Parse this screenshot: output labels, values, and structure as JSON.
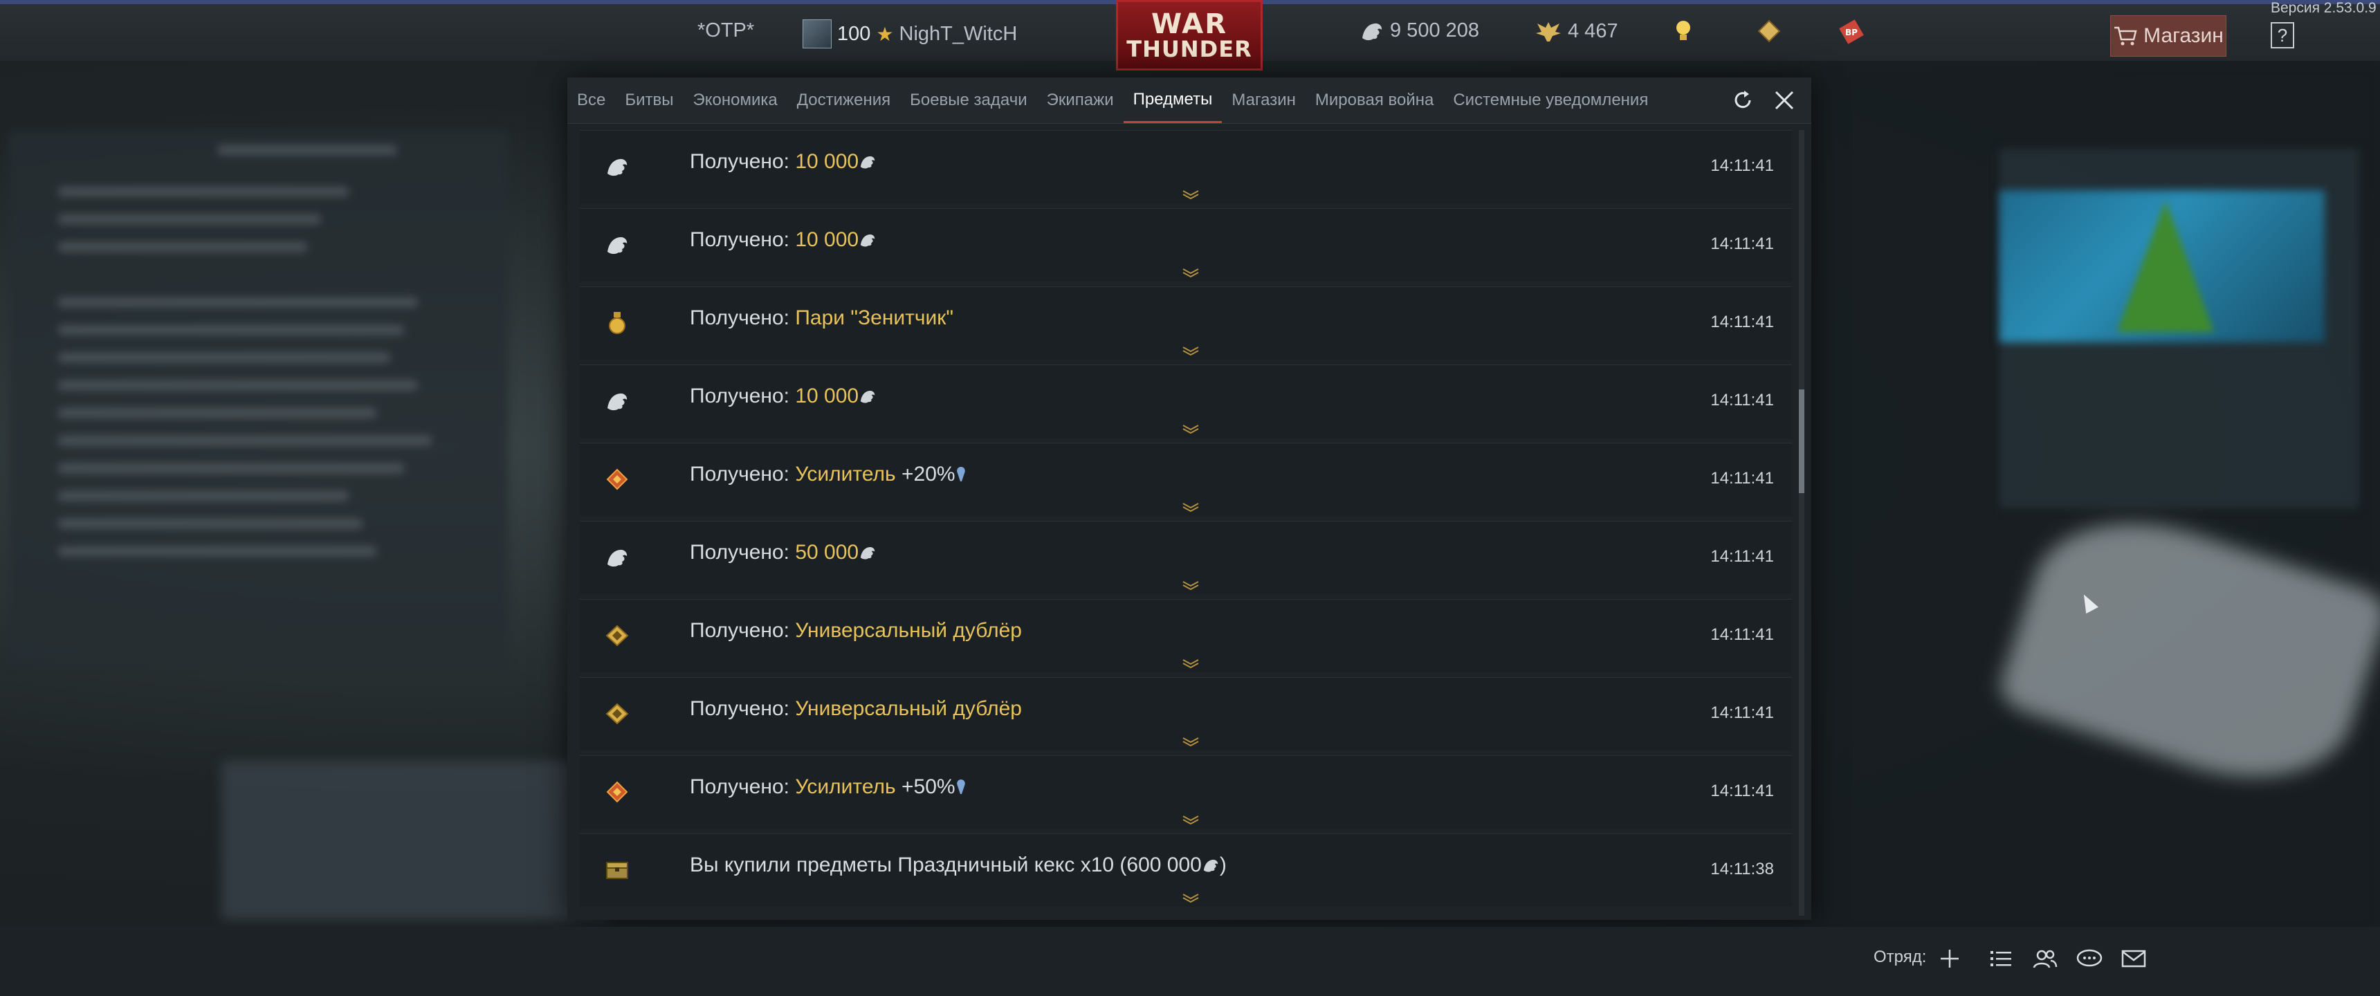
{
  "version": "Версия 2.53.0.9",
  "topbar": {
    "otp": "*ОТР*",
    "rank": "100",
    "nickname": "NighT_WitcH",
    "logo_line1": "WAR",
    "logo_line2": "THUNDER",
    "silver_lions": "9 500 208",
    "golden_eagles": "4 467",
    "shop_label": "Магазин",
    "help_label": "?"
  },
  "tabs": [
    {
      "label": "Все"
    },
    {
      "label": "Битвы"
    },
    {
      "label": "Экономика"
    },
    {
      "label": "Достижения"
    },
    {
      "label": "Боевые задачи"
    },
    {
      "label": "Экипажи"
    },
    {
      "label": "Предметы",
      "active": true
    },
    {
      "label": "Магазин"
    },
    {
      "label": "Мировая война"
    },
    {
      "label": "Системные уведомления"
    }
  ],
  "rows": [
    {
      "icon": "silver-lion-icon",
      "prefix": "Получено: ",
      "highlight": "10 000",
      "suffix": "",
      "time": "14:11:41"
    },
    {
      "icon": "silver-lion-icon",
      "prefix": "Получено: ",
      "highlight": "10 000",
      "suffix": "",
      "time": "14:11:41"
    },
    {
      "icon": "wager-medal-icon",
      "prefix": "Получено: ",
      "highlight": "Пари \"Зенитчик\"",
      "suffix": "",
      "time": "14:11:41"
    },
    {
      "icon": "silver-lion-icon",
      "prefix": "Получено: ",
      "highlight": "10 000",
      "suffix": "",
      "time": "14:11:41"
    },
    {
      "icon": "booster-icon",
      "prefix": "Получено: ",
      "highlight": "Усилитель",
      "suffix": " +20%",
      "time": "14:11:41"
    },
    {
      "icon": "silver-lion-icon",
      "prefix": "Получено: ",
      "highlight": "50 000",
      "suffix": "",
      "time": "14:11:41"
    },
    {
      "icon": "universal-backup-icon",
      "prefix": "Получено: ",
      "highlight": "Универсальный дублёр",
      "suffix": "",
      "time": "14:11:41"
    },
    {
      "icon": "universal-backup-icon",
      "prefix": "Получено: ",
      "highlight": "Универсальный дублёр",
      "suffix": "",
      "time": "14:11:41"
    },
    {
      "icon": "booster-icon",
      "prefix": "Получено: ",
      "highlight": "Усилитель",
      "suffix": " +50%",
      "time": "14:11:41"
    },
    {
      "icon": "chest-icon",
      "prefix": "Вы купили предметы ",
      "highlight": "",
      "suffix": "Праздничный кекс x10 (600 000",
      "suffix2": ")",
      "time": "14:11:38"
    }
  ],
  "bottombar": {
    "squad_label": "Отряд:"
  },
  "colors": {
    "accent_gold": "#e8c25a",
    "active_tab_underline": "#c0463a",
    "shop_button": "#6a3a34",
    "logo_red": "#8d1c1f"
  }
}
